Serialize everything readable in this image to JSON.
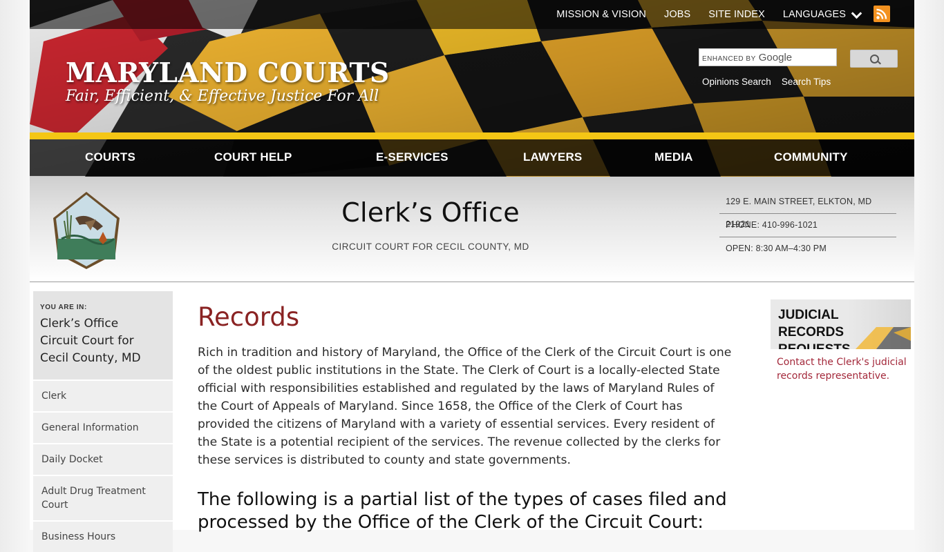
{
  "colors": {
    "gold": "#f4c615",
    "accent_red": "#8a2323",
    "link_red": "#a3283a",
    "rss_orange": "#f39220"
  },
  "topnav": {
    "mission": "MISSION & VISION",
    "jobs": "JOBS",
    "site_index": "SITE INDEX",
    "languages": "LANGUAGES",
    "rss_icon": "rss-icon"
  },
  "brand": {
    "title": "MARYLAND COURTS",
    "tagline": "Fair, Efficient, & Effective Justice For All"
  },
  "search": {
    "enhanced_by": "ENHANCED BY",
    "provider": "Google",
    "opinions_link": "Opinions Search",
    "tips_link": "Search Tips"
  },
  "mainnav": {
    "courts": "COURTS",
    "court_help": "COURT HELP",
    "eservices": "E-SERVICES",
    "lawyers": "LAWYERS",
    "media": "MEDIA",
    "community": "COMMUNITY"
  },
  "office": {
    "title": "Clerk’s Office",
    "subtitle": "CIRCUIT COURT FOR CECIL COUNTY, MD",
    "address": "129 E. MAIN STREET, ELKTON, MD 21921",
    "phone": "PHONE: 410-996-1021",
    "hours": "OPEN: 8:30 AM–4:30 PM"
  },
  "sidebar": {
    "you_are_in": "YOU ARE IN:",
    "location_line1": "Clerk’s Office",
    "location_line2": "Circuit Court for Cecil County, MD",
    "items": [
      {
        "label": "Clerk"
      },
      {
        "label": "General Information"
      },
      {
        "label": "Daily Docket"
      },
      {
        "label": "Adult Drug Treatment Court"
      },
      {
        "label": "Business Hours"
      }
    ]
  },
  "main": {
    "heading": "Records",
    "intro": "Rich in tradition and history of Maryland, the Office of the Clerk of the Circuit Court is one of the oldest public institutions in the State. The Clerk of Court is a locally-elected State official with responsibilities established and regulated by the laws of Maryland Rules of the Court of Appeals of Maryland. Since 1658, the Office of the Clerk of Court has provided the citizens of Maryland with a variety of essential services. Every resident of the State is a potential recipient of the services. The revenue collected by the clerks for these services is distributed to county and state governments.",
    "subheading": "The following is a partial list of the types of cases filed and processed by the Office of the Clerk of the Circuit Court:"
  },
  "widget": {
    "title": "JUDICIAL RECORDS REQUESTS",
    "link": "Contact the Clerk's judicial records representative."
  }
}
